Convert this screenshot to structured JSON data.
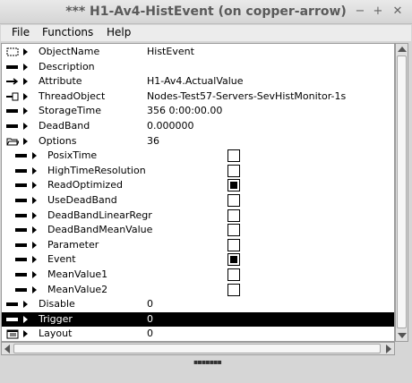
{
  "window": {
    "title": "*** H1-Av4-HistEvent (on copper-arrow)",
    "minimize_glyph": "−",
    "maximize_glyph": "+",
    "close_glyph": "✕"
  },
  "menu": [
    "File",
    "Functions",
    "Help"
  ],
  "rows": [
    {
      "label": "ObjectName",
      "value": "HistEvent",
      "icon": "object-name-icon"
    },
    {
      "label": "Description",
      "value": "",
      "icon": "attribute-icon"
    },
    {
      "label": "Attribute",
      "value": "H1-Av4.ActualValue",
      "icon": "attribute-reference-icon"
    },
    {
      "label": "ThreadObject",
      "value": "Nodes-Test57-Servers-SevHistMonitor-1s",
      "icon": "object-reference-icon"
    },
    {
      "label": "StorageTime",
      "value": "356 0:00:00.00",
      "icon": "attribute-icon"
    },
    {
      "label": "DeadBand",
      "value": "0.000000",
      "icon": "attribute-icon"
    },
    {
      "label": "Options",
      "value": "36",
      "icon": "open-folder-icon"
    },
    {
      "label": "PosixTime",
      "checked": false,
      "icon": "attribute-icon",
      "indent": true
    },
    {
      "label": "HighTimeResolution",
      "checked": false,
      "icon": "attribute-icon",
      "indent": true
    },
    {
      "label": "ReadOptimized",
      "checked": true,
      "icon": "attribute-icon",
      "indent": true
    },
    {
      "label": "UseDeadBand",
      "checked": false,
      "icon": "attribute-icon",
      "indent": true
    },
    {
      "label": "DeadBandLinearRegr",
      "checked": false,
      "icon": "attribute-icon",
      "indent": true
    },
    {
      "label": "DeadBandMeanValue",
      "checked": false,
      "icon": "attribute-icon",
      "indent": true
    },
    {
      "label": "Parameter",
      "checked": false,
      "icon": "attribute-icon",
      "indent": true
    },
    {
      "label": "Event",
      "checked": true,
      "icon": "attribute-icon",
      "indent": true
    },
    {
      "label": "MeanValue1",
      "checked": false,
      "icon": "attribute-icon",
      "indent": true
    },
    {
      "label": "MeanValue2",
      "checked": false,
      "icon": "attribute-icon",
      "indent": true
    },
    {
      "label": "Disable",
      "value": "0",
      "icon": "attribute-icon"
    },
    {
      "label": "Trigger",
      "value": "0",
      "icon": "attribute-icon",
      "selected": true
    },
    {
      "label": "Layout",
      "value": "0",
      "icon": "layout-icon"
    }
  ],
  "status": {
    "grip": "▪▪▪▪▪▪▪"
  }
}
